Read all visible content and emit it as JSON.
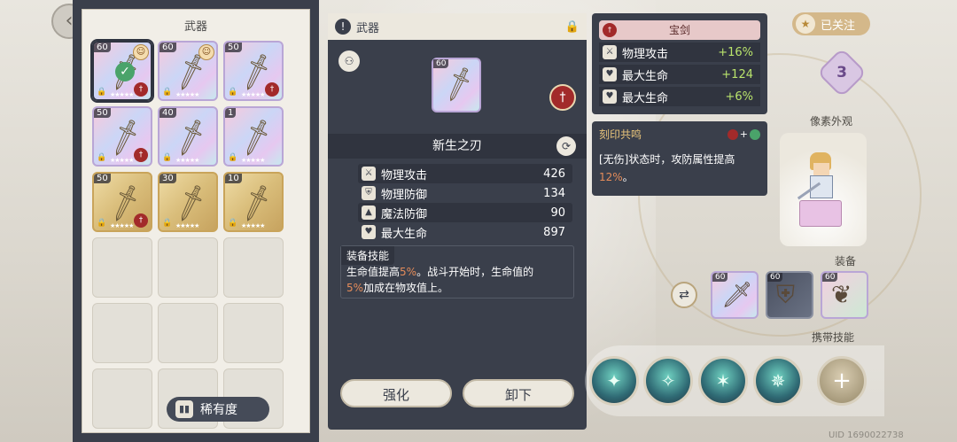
{
  "inventory": {
    "title": "武器",
    "slots": [
      {
        "level": "60",
        "style": "selected",
        "equipped": true,
        "has_avatar": true,
        "badge": true
      },
      {
        "level": "60",
        "style": "rainbow",
        "equipped": false,
        "has_avatar": true,
        "badge": false
      },
      {
        "level": "50",
        "style": "rainbow",
        "equipped": false,
        "has_avatar": false,
        "badge": true
      },
      {
        "level": "50",
        "style": "rainbow",
        "equipped": false,
        "has_avatar": false,
        "badge": true
      },
      {
        "level": "40",
        "style": "rainbow",
        "equipped": false,
        "has_avatar": false,
        "badge": false
      },
      {
        "level": "1",
        "style": "rainbow",
        "equipped": false,
        "has_avatar": false,
        "badge": false
      },
      {
        "level": "50",
        "style": "gold",
        "equipped": false,
        "has_avatar": false,
        "badge": true
      },
      {
        "level": "30",
        "style": "gold",
        "equipped": false,
        "has_avatar": false,
        "badge": false
      },
      {
        "level": "10",
        "style": "gold",
        "equipped": false,
        "has_avatar": false,
        "badge": false
      }
    ],
    "rarity_label": "稀有度"
  },
  "detail": {
    "header_label": "武器",
    "item_level": "60",
    "item_name": "新生之刃",
    "stats": [
      {
        "label": "物理攻击",
        "value": "426",
        "icon": "sword-icon"
      },
      {
        "label": "物理防御",
        "value": "134",
        "icon": "shield-icon"
      },
      {
        "label": "魔法防御",
        "value": "90",
        "icon": "hat-icon"
      },
      {
        "label": "最大生命",
        "value": "897",
        "icon": "heart-icon"
      }
    ],
    "skill_title": "装备技能",
    "skill_text": {
      "part1": "生命值提高",
      "hl1": "5%",
      "part2": "。战斗开始时，生命值的",
      "hl2": "5%",
      "part3": "加成在物攻值上。"
    },
    "enhance_label": "强化",
    "unequip_label": "卸下"
  },
  "treasure": {
    "title": "宝剑",
    "bonuses": [
      {
        "label": "物理攻击",
        "value": "+16%",
        "icon": "sword-icon"
      },
      {
        "label": "最大生命",
        "value": "+124",
        "icon": "heart-icon"
      },
      {
        "label": "最大生命",
        "value": "+6%",
        "icon": "heart-icon"
      }
    ]
  },
  "resonance": {
    "title": "刻印共鸣",
    "plus": "+",
    "text_prefix": "[无伤]状态时，攻防属性提高",
    "text_value": "12%",
    "text_suffix": "。"
  },
  "right": {
    "follow_label": "已关注",
    "rank": "3",
    "appearance_label": "像素外观",
    "equip_label": "装备",
    "carry_skill_label": "携带技能",
    "equip_slots": [
      {
        "level": "60",
        "style": "rainbow"
      },
      {
        "level": "60",
        "style": "dark"
      },
      {
        "level": "60",
        "style": "green"
      }
    ],
    "uid": "UID 1690022738"
  }
}
